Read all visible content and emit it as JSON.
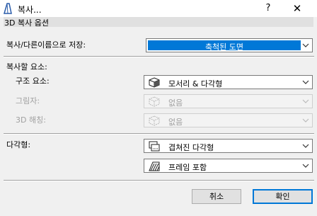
{
  "window": {
    "title": "복사...",
    "help": "?",
    "close": "✕"
  },
  "section": {
    "header": "3D 복사 옵션"
  },
  "save_as": {
    "label": "복사/다른이름으로 저장:",
    "value": "축척된 도면"
  },
  "copy_elements": {
    "label": "복사할 요소:",
    "structure": {
      "label": "구조 요소:",
      "value": "모서리 & 다각형"
    },
    "shadow": {
      "label": "그림자:",
      "value": "없음"
    },
    "hatching": {
      "label": "3D 해칭:",
      "value": "없음"
    }
  },
  "polygon": {
    "label": "다각형:",
    "overlap": {
      "value": "겹쳐진 다각형"
    },
    "frame": {
      "value": "프레임 포함"
    }
  },
  "buttons": {
    "cancel": "취소",
    "ok": "확인"
  },
  "colors": {
    "accent": "#0078d7",
    "background": "#f0f0f0"
  }
}
